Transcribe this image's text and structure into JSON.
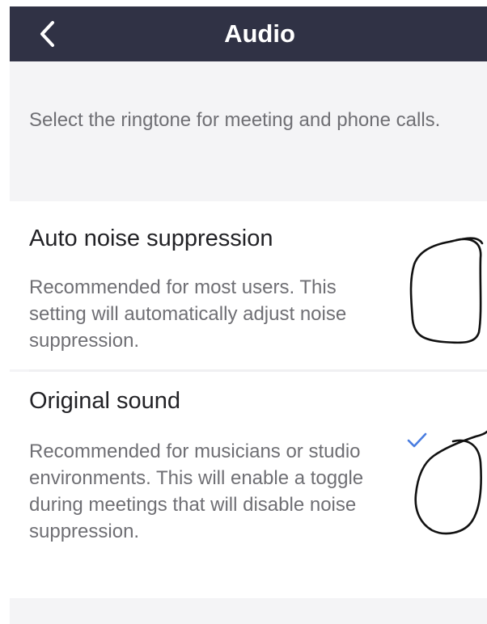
{
  "header": {
    "title": "Audio",
    "background": "#303245"
  },
  "description": "Select the ringtone for meeting and phone calls.",
  "options": [
    {
      "title": "Auto noise suppression",
      "description": "Recommended for most users. This setting will automatically adjust noise suppression.",
      "selected": false
    },
    {
      "title": "Original sound",
      "description": "Recommended for musicians or studio environments. This will enable a toggle during meetings that will disable noise suppression.",
      "selected": true
    }
  ],
  "colors": {
    "accent": "#4a7de0",
    "page_background": "#f4f4f6",
    "annotation": "#111111"
  },
  "icons": {
    "back": "chevron-left-icon",
    "selected": "checkmark-icon"
  }
}
